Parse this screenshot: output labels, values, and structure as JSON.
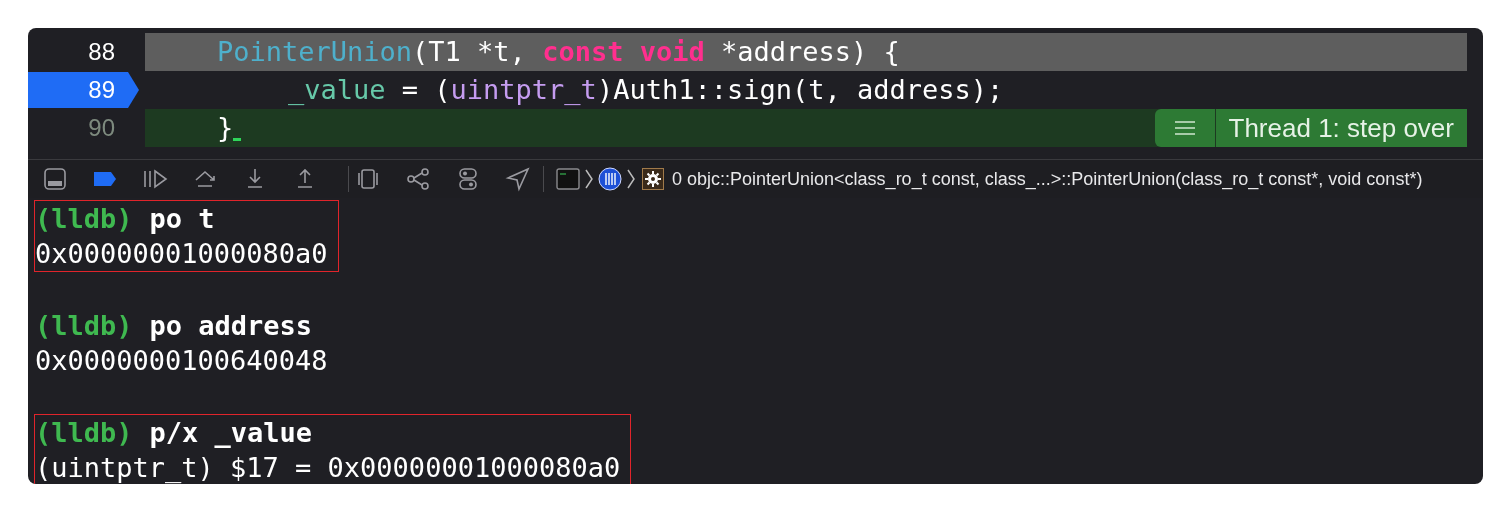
{
  "editor": {
    "lines": [
      {
        "number": "88",
        "kind": "selected",
        "breakpoint": false,
        "tokens": [
          {
            "kind": "type",
            "text": "PointerUnion"
          },
          {
            "kind": "plain",
            "text": "(T1 *t, "
          },
          {
            "kind": "keyword",
            "text": "const void"
          },
          {
            "kind": "plain",
            "text": " *address) {"
          }
        ],
        "children": [
          {
            "number": "89",
            "kind": "plain",
            "breakpoint": true,
            "tokens": [
              {
                "kind": "variable",
                "text": "_value"
              },
              {
                "kind": "plain",
                "text": " = ("
              },
              {
                "kind": "typename",
                "text": "uintptr_t"
              },
              {
                "kind": "plain",
                "text": ")Auth1::sign(t, address);"
              }
            ]
          }
        ]
      },
      {
        "number": "90",
        "kind": "current",
        "breakpoint": false,
        "tokens": [
          {
            "kind": "plain",
            "text": "}"
          }
        ]
      }
    ],
    "thread_badge": {
      "label": "Thread 1: step over"
    }
  },
  "debug_bar": {
    "frame": "0 objc::PointerUnion<class_ro_t const, class_...>::PointerUnion(class_ro_t const*, void const*)"
  },
  "console": {
    "entries": [
      {
        "prompt": "(lldb)",
        "command": "po t",
        "output": "0x00000001000080a0",
        "highlighted": true
      },
      {
        "prompt": "(lldb)",
        "command": "po address",
        "output": "0x0000000100640048",
        "highlighted": false
      },
      {
        "prompt": "(lldb)",
        "command": "p/x _value",
        "output": "(uintptr_t) $17 = 0x00000001000080a0",
        "highlighted": true
      }
    ]
  }
}
